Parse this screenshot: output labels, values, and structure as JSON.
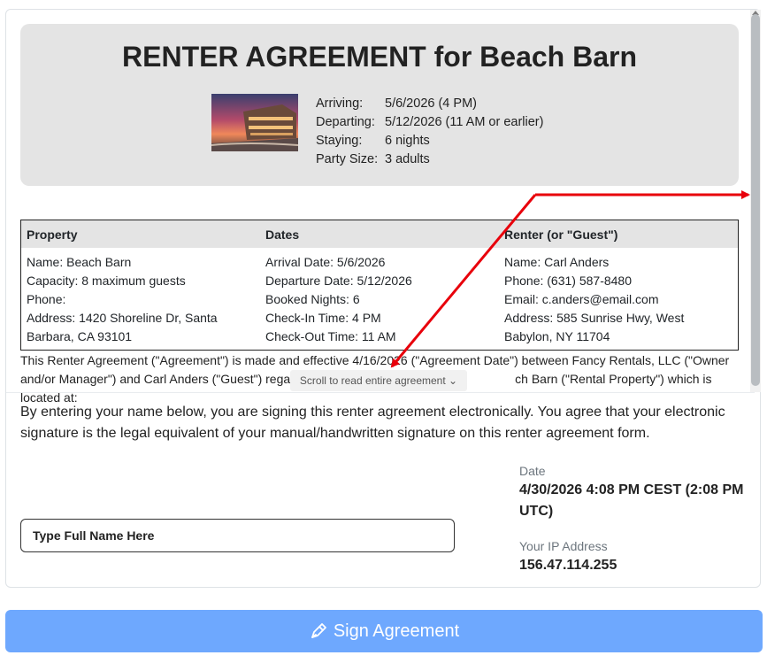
{
  "header": {
    "title": "RENTER AGREEMENT for Beach Barn",
    "summary": [
      {
        "key": "Arriving:",
        "value": "5/6/2026 (4 PM)"
      },
      {
        "key": "Departing:",
        "value": "5/12/2026 (11 AM or earlier)"
      },
      {
        "key": "Staying:",
        "value": "6 nights"
      },
      {
        "key": "Party Size:",
        "value": "3 adults"
      }
    ]
  },
  "table": {
    "headers": [
      "Property",
      "Dates",
      "Renter (or \"Guest\")"
    ],
    "property": [
      "Name: Beach Barn",
      "Capacity: 8 maximum guests",
      "Phone:",
      "Address: 1420 Shoreline Dr, Santa Barbara, CA 93101"
    ],
    "dates": [
      "Arrival Date: 5/6/2026",
      "Departure Date: 5/12/2026",
      "Booked Nights: 6",
      "Check-In Time: 4 PM",
      "Check-Out Time: 11 AM"
    ],
    "renter": [
      "Name: Carl Anders",
      "Phone: (631) 587-8480",
      "Email: c.anders@email.com",
      "Address: 585 Sunrise Hwy, West Babylon, NY 11704"
    ]
  },
  "agreement": {
    "line1": "This Renter Agreement (\"Agreement\") is made and effective 4/16/2026 (\"Agreement Date\") between Fancy Rentals, LLC (\"Owner",
    "line2_a": "and/or Manager\") and Carl Anders (\"Guest\") rega",
    "line2_b": "ch Barn (\"Rental Property\") which is located at:",
    "scroll_hint": "Scroll to read entire agreement ⌄"
  },
  "signature": {
    "consent": "By entering your name below, you are signing this renter agreement electronically. You agree that your electronic signature is the legal equivalent of your manual/handwritten signature on this renter agreement form.",
    "name_placeholder": "Type Full Name Here",
    "date_label": "Date",
    "date_value": "4/30/2026 4:08 PM CEST (2:08 PM UTC)",
    "ip_label": "Your IP Address",
    "ip_value": "156.47.114.255"
  },
  "sign_button": {
    "label": "Sign Agreement",
    "icon": "pen-icon"
  },
  "colors": {
    "button": "#6ea8fe",
    "annotation_arrow": "#e8000b",
    "header_bg": "#e4e4e4"
  }
}
